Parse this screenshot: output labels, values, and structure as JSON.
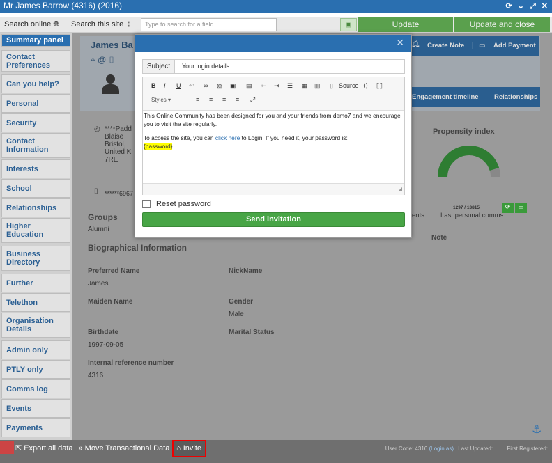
{
  "window": {
    "title": "Mr James Barrow (4316) (2016)"
  },
  "toolbar": {
    "search_online": "Search online",
    "search_site": "Search this site",
    "search_placeholder": "Type to search for a field",
    "update": "Update",
    "update_close": "Update and close"
  },
  "sidebar": {
    "items": [
      "Summary panel",
      "Contact Preferences",
      "Can you help?",
      "Personal",
      "Security",
      "Contact Information",
      "Interests",
      "School",
      "Relationships",
      "Higher Education",
      "Business Directory",
      "Further",
      "Telethon",
      "Organisation Details",
      "Admin only",
      "PTLY only",
      "Comms log",
      "Events",
      "Payments"
    ]
  },
  "profile": {
    "name": "James Ba",
    "address": [
      "****Padd",
      "Blaise",
      "Bristol,",
      "United Ki",
      "7RE"
    ],
    "phone": "******6967",
    "create_note": "Create Note",
    "add_payment": "Add Payment",
    "engagement": "Engagement timeline",
    "relationships": "Relationships",
    "propensity": "Propensity index",
    "gauge_value": "1297 / 13815",
    "gauge_fraction": 0.094
  },
  "groups": {
    "label": "Groups",
    "value": "Alumni"
  },
  "tabs": {
    "events": "ents",
    "last_comms": "Last personal comms",
    "note": "Note"
  },
  "bio": {
    "title": "Biographical Information",
    "preferred_label": "Preferred Name",
    "preferred_value": "James",
    "nickname_label": "NickName",
    "maiden_label": "Maiden Name",
    "gender_label": "Gender",
    "gender_value": "Male",
    "birthdate_label": "Birthdate",
    "birthdate_value": "1997-09-05",
    "marital_label": "Marital Status",
    "internal_label": "Internal reference number",
    "internal_value": "4316"
  },
  "modal": {
    "subject_label": "Subject",
    "subject_value": "Your login details",
    "styles": "Styles",
    "source": "Source",
    "body_p1": "This Online Community has been designed for you and your friends from demo7 and we encourage you to visit the site regularly.",
    "body_p2a": "To access the site, you can ",
    "body_p2_link": "click here",
    "body_p2b": " to Login. If you need it, your password is:",
    "body_password": "{password}",
    "reset_label": "Reset password",
    "send_label": "Send invitation"
  },
  "status": {
    "export": "Export all data",
    "move": "Move Transactional Data",
    "invite": "Invite",
    "user_code": "User Code: 4316",
    "login_as": "(Login as)",
    "last_updated": "Last Updated:",
    "first_registered": "First Registered:"
  }
}
